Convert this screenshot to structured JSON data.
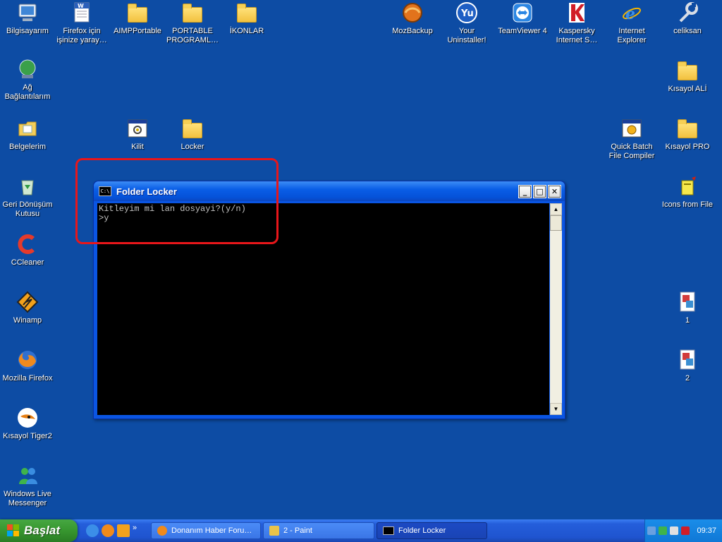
{
  "desktop": {
    "icons_left": [
      {
        "label": "Bilgisayarım",
        "icon": "computer-icon"
      },
      {
        "label": "Ağ\nBağlantılarım",
        "icon": "network-icon"
      },
      {
        "label": "Belgelerim",
        "icon": "documents-folder-icon"
      },
      {
        "label": "Geri Dönüşüm\nKutusu",
        "icon": "recycle-bin-icon"
      },
      {
        "label": "CCleaner",
        "icon": "ccleaner-icon"
      },
      {
        "label": "Winamp",
        "icon": "winamp-icon"
      },
      {
        "label": "Mozilla Firefox",
        "icon": "firefox-icon"
      },
      {
        "label": "Kısayol Tiger2",
        "icon": "tiger-icon"
      },
      {
        "label": "Windows Live\nMessenger",
        "icon": "messenger-icon"
      }
    ],
    "icons_top": [
      {
        "label": "Firefox için\nişinize yaray…",
        "icon": "word-document-icon"
      },
      {
        "label": "AIMPPortable",
        "icon": "folder-icon"
      },
      {
        "label": "PORTABLE\nPROGRAML…",
        "icon": "folder-icon"
      },
      {
        "label": "İKONLAR",
        "icon": "folder-icon"
      },
      {
        "label": "Kilit",
        "icon": "batch-file-icon"
      },
      {
        "label": "Locker",
        "icon": "folder-icon"
      }
    ],
    "icons_right": [
      {
        "label": "MozBackup",
        "icon": "mozbackup-icon"
      },
      {
        "label": "Your\nUninstaller!",
        "icon": "uninstaller-icon"
      },
      {
        "label": "TeamViewer 4",
        "icon": "teamviewer-icon"
      },
      {
        "label": "Kaspersky\nInternet S…",
        "icon": "kaspersky-icon"
      },
      {
        "label": "Internet\nExplorer",
        "icon": "internet-explorer-icon"
      },
      {
        "label": "celiksan",
        "icon": "tools-icon"
      },
      {
        "label": "Kısayol ALİ",
        "icon": "folder-icon"
      },
      {
        "label": "Quick Batch\nFile Compiler",
        "icon": "batch-compiler-icon"
      },
      {
        "label": "Kısayol PRO",
        "icon": "folder-icon"
      },
      {
        "label": "Icons from File",
        "icon": "icons-from-file-icon"
      },
      {
        "label": "1",
        "icon": "image-file-icon"
      },
      {
        "label": "2",
        "icon": "image-file-icon"
      }
    ]
  },
  "window": {
    "title": "Folder Locker",
    "title_icon_text": "C:\\",
    "minimize": "_",
    "maximize": "□",
    "close": "✕",
    "console_lines": [
      "Kitleyim mi lan dosyayi?(y/n)",
      ">y"
    ]
  },
  "taskbar": {
    "start_label": "Başlat",
    "more_arrows": "»",
    "tasks": [
      {
        "label": "Donanım Haber Foru…",
        "icon": "firefox-icon"
      },
      {
        "label": "2 - Paint",
        "icon": "paint-icon"
      },
      {
        "label": "Folder Locker",
        "icon": "console-icon"
      }
    ],
    "clock": "09:37"
  },
  "colors": {
    "desktop": "#0d4ca4",
    "highlight": "#e8161a",
    "console_bg": "#000000",
    "console_text": "#c0c0c0"
  }
}
